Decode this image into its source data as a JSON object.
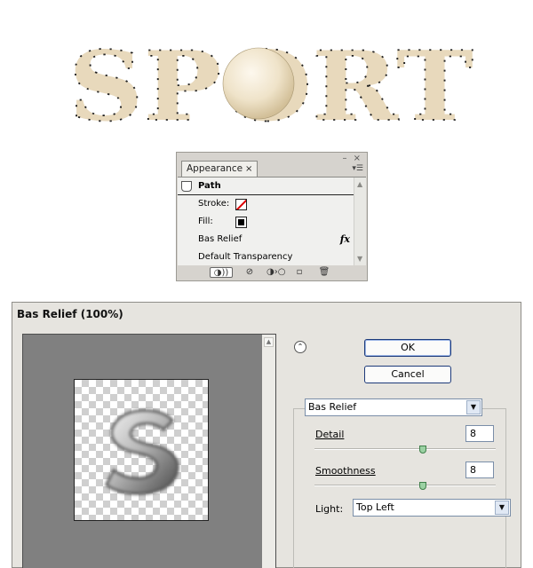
{
  "artwork": {
    "text": "SPORT",
    "fill": "#e8d9bc",
    "stroke": "#777777"
  },
  "appearance": {
    "tab_label": "Appearance",
    "tab_close": "×",
    "window_controls": "– ×",
    "path_label": "Path",
    "stroke_label": "Stroke:",
    "fill_label": "Fill:",
    "effect_label": "Bas Relief",
    "fx_icon": "fx",
    "transparency_label": "Default Transparency"
  },
  "dialog": {
    "title": "Bas Relief (100%)",
    "ok_label": "OK",
    "cancel_label": "Cancel",
    "filter_value": "Bas Relief",
    "detail_label": "Detail",
    "detail_value": "8",
    "detail_level": 0.6,
    "smoothness_label": "Smoothness",
    "smoothness_value": "8",
    "smoothness_level": 0.6,
    "light_label": "Light:",
    "light_value": "Top Left"
  }
}
